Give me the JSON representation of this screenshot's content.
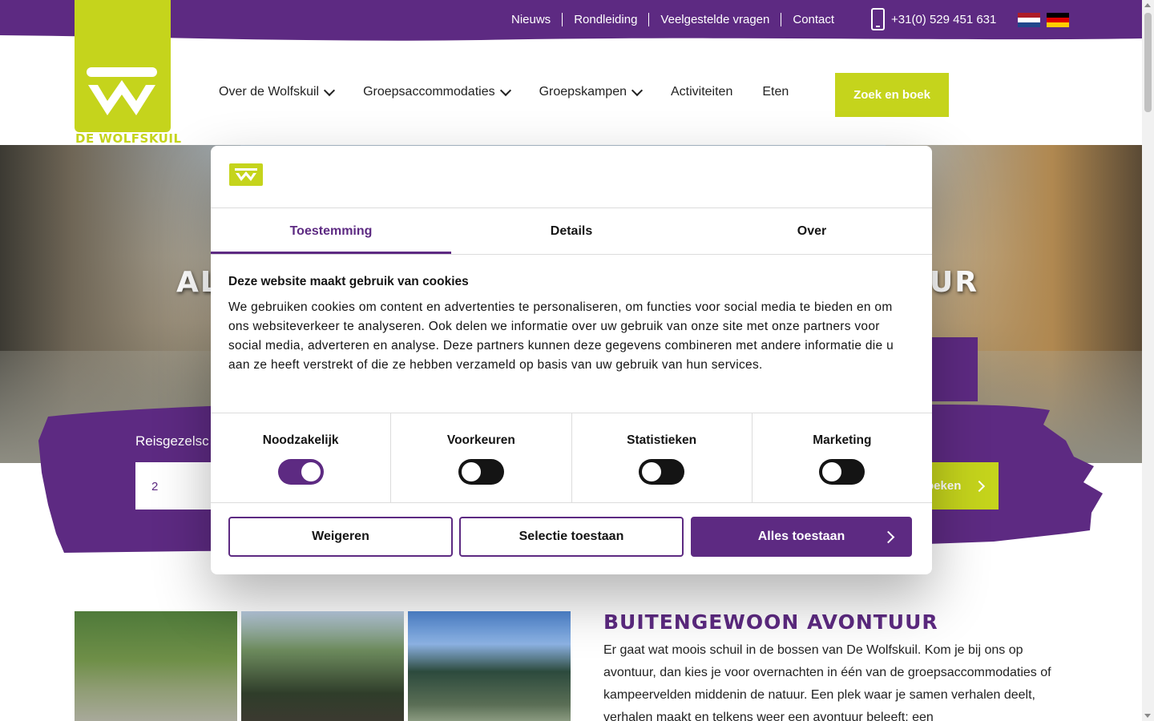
{
  "topbar": {
    "links": [
      "Nieuws",
      "Rondleiding",
      "Veelgestelde vragen",
      "Contact"
    ],
    "phone": "+31(0) 529 451 631",
    "flags": [
      "flag-nl-icon",
      "flag-de-icon"
    ]
  },
  "logo": {
    "text": "DE WOLFSKUIL"
  },
  "nav": {
    "items": [
      "Over de Wolfskuil",
      "Groepsaccommodaties",
      "Groepskampen",
      "Activiteiten",
      "Eten"
    ],
    "cta": "Zoek en boek"
  },
  "hero": {
    "title_left": "AL",
    "title_right": "UR"
  },
  "booking": {
    "label": "Reisgezelsc",
    "input_value": "2",
    "search_label": "oeken"
  },
  "content": {
    "title": "BUITENGEWOON AVONTUUR",
    "text": "Er gaat wat moois schuil in de bossen van De Wolfskuil. Kom je bij ons op avontuur, dan kies je voor overnachten in één van de groepsaccommodaties of kampeervelden middenin de natuur. Een plek waar je samen verhalen deelt, verhalen maakt en telkens weer een avontuur beleeft: een"
  },
  "cookie": {
    "tabs": [
      "Toestemming",
      "Details",
      "Over"
    ],
    "heading": "Deze website maakt gebruik van cookies",
    "body": "We gebruiken cookies om content en advertenties te personaliseren, om functies voor social media te bieden en om ons websiteverkeer te analyseren. Ook delen we informatie over uw gebruik van onze site met onze partners voor social media, adverteren en analyse. Deze partners kunnen deze gegevens combineren met andere informatie die u aan ze heeft verstrekt of die ze hebben verzameld op basis van uw gebruik van hun services.",
    "toggles": [
      {
        "label": "Noodzakelijk",
        "on": true
      },
      {
        "label": "Voorkeuren",
        "on": false
      },
      {
        "label": "Statistieken",
        "on": false
      },
      {
        "label": "Marketing",
        "on": false
      }
    ],
    "buttons": {
      "deny": "Weigeren",
      "selection": "Selectie toestaan",
      "all": "Alles toestaan"
    }
  },
  "colors": {
    "purple": "#5d2a82",
    "lime": "#c5d41c"
  }
}
